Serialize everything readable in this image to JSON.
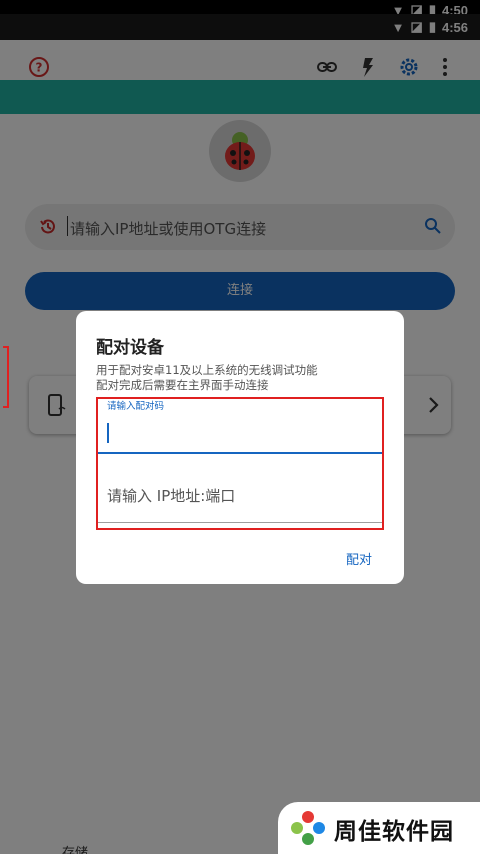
{
  "status_bar_top": {
    "time": "4:50"
  },
  "status_bar_main": {
    "time": "4:56"
  },
  "toolbar": {
    "help_icon": "help-circle-icon",
    "link_icon": "link-icon",
    "flash_icon": "flash-icon",
    "settings_icon": "gear-icon",
    "more_icon": "more-vertical-icon"
  },
  "search": {
    "placeholder": "请输入IP地址或使用OTG连接",
    "history_icon": "history-icon",
    "search_icon": "search-icon"
  },
  "connect_button": {
    "label": "连接"
  },
  "device_card": {
    "icon": "phone-wifi-icon",
    "arrow_icon": "chevron-right-icon"
  },
  "bottom_text": "存储",
  "dialog": {
    "title": "配对设备",
    "description_line1": "用于配对安卓11及以上系统的无线调试功能",
    "description_line2": "配对完成后需要在主界面手动连接",
    "pair_code_label": "请输入配对码",
    "pair_code_value": "",
    "ip_port_placeholder": "请输入 IP地址:端口",
    "pair_button": "配对"
  },
  "watermark": {
    "text": "周佳软件园"
  },
  "colors": {
    "accent": "#1565c0",
    "teal": "#20b3a2",
    "annotation_red": "#e02020"
  }
}
